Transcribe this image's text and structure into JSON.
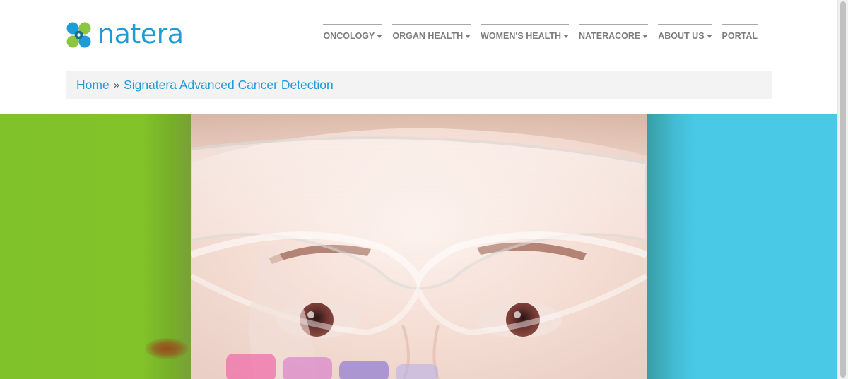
{
  "brand": {
    "name": "natera",
    "colors": {
      "logo_text": "#1f9bd8",
      "logo_green": "#8cc63f",
      "logo_blue": "#1f9bd8",
      "nav_text": "#7d7d7d",
      "breadcrumb_link": "#1f9bd8",
      "hero_green": "#82c32a",
      "hero_blue": "#4ac9e6"
    }
  },
  "nav": {
    "items": [
      {
        "label": "ONCOLOGY",
        "has_dropdown": true
      },
      {
        "label": "ORGAN HEALTH",
        "has_dropdown": true
      },
      {
        "label": "WOMEN'S HEALTH",
        "has_dropdown": true
      },
      {
        "label": "NATERACORE",
        "has_dropdown": true
      },
      {
        "label": "ABOUT US",
        "has_dropdown": true
      },
      {
        "label": "PORTAL",
        "has_dropdown": false
      }
    ]
  },
  "breadcrumb": {
    "home": "Home",
    "separator": "»",
    "current": "Signatera Advanced Cancer Detection"
  },
  "hero": {
    "image": "scientist-with-safety-goggles-photo",
    "icons": [
      "logo-mark-icon",
      "chevron-down-icon"
    ]
  }
}
